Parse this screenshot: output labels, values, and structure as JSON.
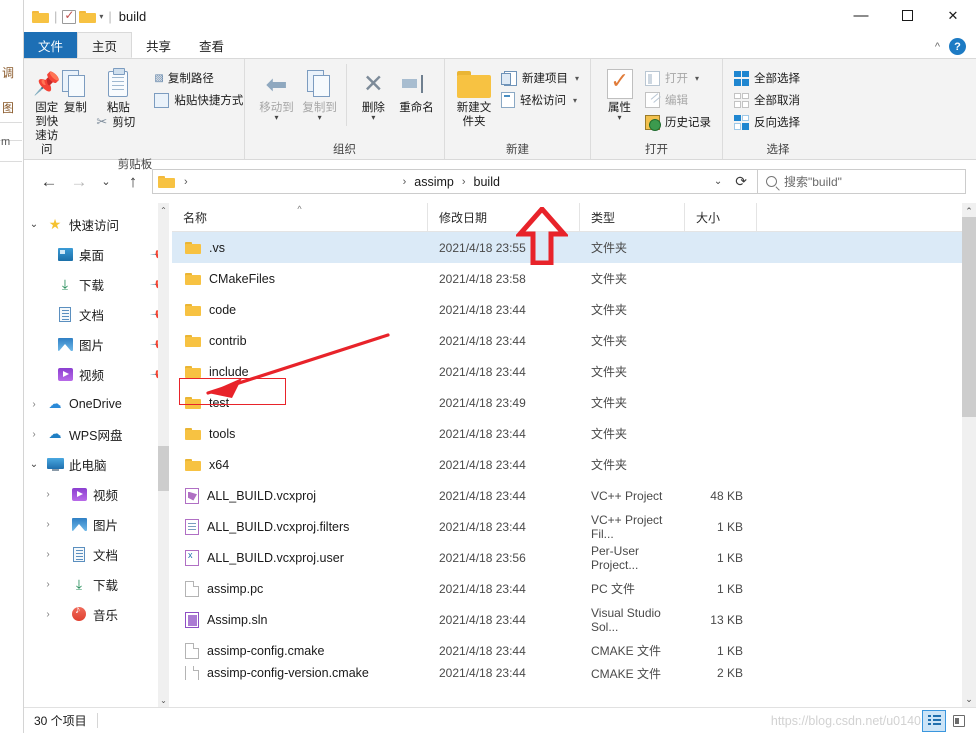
{
  "window": {
    "title": "build",
    "quick_access_toolbar": [
      {
        "name": "folder-icon",
        "label": ""
      },
      {
        "name": "properties-check-icon",
        "label": ""
      },
      {
        "name": "new-folder-icon",
        "label": ""
      },
      {
        "name": "customize-caret-icon",
        "label": "▾"
      }
    ],
    "controls": {
      "minimize": "—",
      "maximize": "▢",
      "close": "✕"
    },
    "ribbon_collapse": "^",
    "help": "?"
  },
  "tabs": [
    {
      "id": "file",
      "label": "文件"
    },
    {
      "id": "home",
      "label": "主页"
    },
    {
      "id": "share",
      "label": "共享"
    },
    {
      "id": "view",
      "label": "查看"
    }
  ],
  "ribbon": {
    "groups": [
      {
        "name": "clipboard",
        "label": "剪贴板",
        "big_buttons": [
          {
            "name": "pin-to-quick-access",
            "label": "固定到快速访问",
            "icon": "pin-icon",
            "disabled": false
          },
          {
            "name": "copy",
            "label": "复制",
            "icon": "copy-documents-icon",
            "disabled": false
          },
          {
            "name": "paste",
            "label": "粘贴",
            "icon": "clipboard-icon",
            "disabled": false
          }
        ],
        "small_buttons": [
          {
            "name": "copy-path",
            "label": "复制路径",
            "icon": "copy-path-icon"
          },
          {
            "name": "paste-shortcut",
            "label": "粘贴快捷方式",
            "icon": "paste-shortcut-icon"
          },
          {
            "name": "cut",
            "label": "剪切",
            "icon": "scissors-icon"
          }
        ]
      },
      {
        "name": "organize",
        "label": "组织",
        "big_buttons": [
          {
            "name": "move-to",
            "label": "移动到",
            "icon": "move-to-icon",
            "caret": "▾",
            "disabled": true
          },
          {
            "name": "copy-to",
            "label": "复制到",
            "icon": "copy-to-icon",
            "caret": "▾",
            "disabled": true
          },
          {
            "name": "delete",
            "label": "删除",
            "icon": "delete-x-icon",
            "caret": "▾",
            "disabled": false
          },
          {
            "name": "rename",
            "label": "重命名",
            "icon": "rename-icon",
            "disabled": false
          }
        ]
      },
      {
        "name": "new",
        "label": "新建",
        "big_buttons": [
          {
            "name": "new-folder",
            "label": "新建文件夹",
            "icon": "new-folder-icon",
            "disabled": false
          }
        ],
        "small_buttons": [
          {
            "name": "new-item",
            "label": "新建项目",
            "icon": "new-item-icon",
            "caret": "▾"
          },
          {
            "name": "easy-access",
            "label": "轻松访问",
            "icon": "easy-access-icon",
            "caret": "▾"
          }
        ]
      },
      {
        "name": "open",
        "label": "打开",
        "big_buttons": [
          {
            "name": "properties",
            "label": "属性",
            "icon": "properties-icon",
            "caret": "▾",
            "disabled": false
          }
        ],
        "small_buttons": [
          {
            "name": "open",
            "label": "打开",
            "icon": "open-icon",
            "caret": "▾",
            "disabled": true
          },
          {
            "name": "edit",
            "label": "编辑",
            "icon": "edit-icon",
            "disabled": true
          },
          {
            "name": "history",
            "label": "历史记录",
            "icon": "history-icon",
            "disabled": false
          }
        ]
      },
      {
        "name": "select",
        "label": "选择",
        "small_buttons": [
          {
            "name": "select-all",
            "label": "全部选择",
            "icon": "select-all-icon"
          },
          {
            "name": "select-none",
            "label": "全部取消",
            "icon": "select-none-icon"
          },
          {
            "name": "invert-selection",
            "label": "反向选择",
            "icon": "invert-selection-icon"
          }
        ]
      }
    ]
  },
  "navigation": {
    "back": "←",
    "forward": "→",
    "recent": "⌄",
    "up": "↑",
    "breadcrumb": [
      {
        "label": "assimp"
      },
      {
        "label": "build"
      }
    ],
    "breadcrumb_caret": "⌄",
    "refresh": "⟳",
    "search_placeholder": "搜索\"build\""
  },
  "sidebar": {
    "items": [
      {
        "name": "quick-access",
        "label": "快速访问",
        "icon": "star-icon",
        "chevron": "⌄",
        "expanded": true,
        "level": 1,
        "pin": false
      },
      {
        "name": "desktop",
        "label": "桌面",
        "icon": "desktop-icon",
        "level": 3,
        "pin": true
      },
      {
        "name": "downloads",
        "label": "下载",
        "icon": "download-icon",
        "level": 3,
        "pin": true
      },
      {
        "name": "documents",
        "label": "文档",
        "icon": "documents-icon",
        "level": 3,
        "pin": true
      },
      {
        "name": "pictures",
        "label": "图片",
        "icon": "pictures-icon",
        "level": 3,
        "pin": true
      },
      {
        "name": "videos",
        "label": "视频",
        "icon": "videos-icon",
        "level": 3,
        "pin": true
      },
      {
        "name": "onedrive",
        "label": "OneDrive",
        "icon": "cloud-icon",
        "chevron": "›",
        "level": 1,
        "pin": false
      },
      {
        "name": "wps-cloud",
        "label": "WPS网盘",
        "icon": "wps-cloud-icon",
        "chevron": "›",
        "level": 1,
        "pin": false
      },
      {
        "name": "this-pc",
        "label": "此电脑",
        "icon": "computer-icon",
        "chevron": "⌄",
        "expanded": true,
        "level": 1,
        "pin": false
      },
      {
        "name": "pc-videos",
        "label": "视频",
        "icon": "videos-icon",
        "chevron": "›",
        "level": 2,
        "pin": false
      },
      {
        "name": "pc-pictures",
        "label": "图片",
        "icon": "pictures-icon",
        "chevron": "›",
        "level": 2,
        "pin": false
      },
      {
        "name": "pc-documents",
        "label": "文档",
        "icon": "documents-icon",
        "chevron": "›",
        "level": 2,
        "pin": false
      },
      {
        "name": "pc-downloads",
        "label": "下载",
        "icon": "download-icon",
        "chevron": "›",
        "level": 2,
        "pin": false
      },
      {
        "name": "pc-music",
        "label": "音乐",
        "icon": "music-icon",
        "chevron": "›",
        "level": 2,
        "pin": false
      }
    ]
  },
  "filelist": {
    "columns": [
      {
        "name": "name",
        "label": "名称",
        "sorted": true,
        "sort_mark": "^"
      },
      {
        "name": "date",
        "label": "修改日期"
      },
      {
        "name": "type",
        "label": "类型"
      },
      {
        "name": "size",
        "label": "大小"
      }
    ],
    "rows": [
      {
        "icon": "folder-icon",
        "name": ".vs",
        "date": "2021/4/18 23:55",
        "type": "文件夹",
        "size": "",
        "selected": true
      },
      {
        "icon": "folder-icon",
        "name": "CMakeFiles",
        "date": "2021/4/18 23:58",
        "type": "文件夹",
        "size": ""
      },
      {
        "icon": "folder-icon",
        "name": "code",
        "date": "2021/4/18 23:44",
        "type": "文件夹",
        "size": ""
      },
      {
        "icon": "folder-icon",
        "name": "contrib",
        "date": "2021/4/18 23:44",
        "type": "文件夹",
        "size": ""
      },
      {
        "icon": "folder-icon",
        "name": "include",
        "date": "2021/4/18 23:44",
        "type": "文件夹",
        "size": "",
        "highlighted": true
      },
      {
        "icon": "folder-icon",
        "name": "test",
        "date": "2021/4/18 23:49",
        "type": "文件夹",
        "size": ""
      },
      {
        "icon": "folder-icon",
        "name": "tools",
        "date": "2021/4/18 23:44",
        "type": "文件夹",
        "size": ""
      },
      {
        "icon": "folder-icon",
        "name": "x64",
        "date": "2021/4/18 23:44",
        "type": "文件夹",
        "size": ""
      },
      {
        "icon": "vcxproj-icon",
        "name": "ALL_BUILD.vcxproj",
        "date": "2021/4/18 23:44",
        "type": "VC++ Project",
        "size": "48 KB"
      },
      {
        "icon": "vcxproj-filters-icon",
        "name": "ALL_BUILD.vcxproj.filters",
        "date": "2021/4/18 23:44",
        "type": "VC++ Project Fil...",
        "size": "1 KB"
      },
      {
        "icon": "vcxproj-user-icon",
        "name": "ALL_BUILD.vcxproj.user",
        "date": "2021/4/18 23:56",
        "type": "Per-User Project...",
        "size": "1 KB"
      },
      {
        "icon": "blank-file-icon",
        "name": "assimp.pc",
        "date": "2021/4/18 23:44",
        "type": "PC 文件",
        "size": "1 KB"
      },
      {
        "icon": "sln-icon",
        "name": "Assimp.sln",
        "date": "2021/4/18 23:44",
        "type": "Visual Studio Sol...",
        "size": "13 KB"
      },
      {
        "icon": "blank-file-icon",
        "name": "assimp-config.cmake",
        "date": "2021/4/18 23:44",
        "type": "CMAKE 文件",
        "size": "1 KB"
      },
      {
        "icon": "blank-file-icon",
        "name": "assimp-config-version.cmake",
        "date": "2021/4/18 23:44",
        "type": "CMAKE 文件",
        "size": "2 KB",
        "clipped": true
      }
    ]
  },
  "statusbar": {
    "item_count": "30 个项目",
    "view_details": "details-view-icon",
    "view_tiles": "tiles-view-icon"
  },
  "watermark": "https://blog.csdn.net/u0140",
  "annotations": {
    "up_arrow_color": "#e8232a",
    "rect_color": "#e8232a",
    "diagonal_arrow_color": "#e8232a",
    "up_arrow_target": "build",
    "rect_target": "include"
  },
  "background_window": {
    "glyphs": [
      "调",
      "图"
    ],
    "text": "m"
  }
}
